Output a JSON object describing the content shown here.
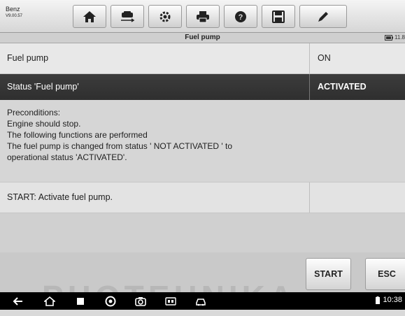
{
  "toolbar": {
    "brand": "Benz",
    "version": "V9.00.57",
    "buttons": [
      "home-icon",
      "vehicle-swap-icon",
      "settings-icon",
      "print-icon",
      "help-icon",
      "save-icon",
      "edit-icon"
    ]
  },
  "titlebar": {
    "title": "Fuel pump",
    "battery": "11.8"
  },
  "rows": [
    {
      "label": "Fuel pump",
      "value": "ON"
    },
    {
      "label": "Status 'Fuel pump'",
      "value": "ACTIVATED"
    }
  ],
  "preconditions": {
    "lines": [
      "Preconditions:",
      "Engine should stop.",
      "The following functions are performed",
      "The fuel pump is changed from status ' NOT ACTIVATED ' to",
      "operational status 'ACTIVATED'."
    ]
  },
  "start_row": {
    "label": "START: Activate fuel pump."
  },
  "buttons": {
    "start": "START",
    "esc": "ESC"
  },
  "watermark": "PHOTEHNIKA",
  "system_bar": {
    "icons": [
      "back-icon",
      "home-icon",
      "recent-apps-icon",
      "browser-icon",
      "camera-icon",
      "vci-icon",
      "car-icon"
    ],
    "time": "10:38"
  },
  "colors": {
    "status_row_bg": "#333333",
    "page_bg": "#d9d9d9"
  }
}
